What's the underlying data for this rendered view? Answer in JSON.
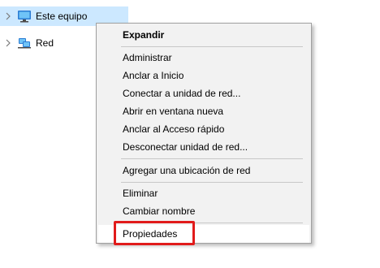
{
  "tree": {
    "items": [
      {
        "label": "Este equipo",
        "icon": "computer-icon",
        "selected": true
      },
      {
        "label": "Red",
        "icon": "network-icon",
        "selected": false
      }
    ]
  },
  "context_menu": {
    "items": [
      {
        "label": "Expandir",
        "bold": true
      },
      {
        "label": "Administrar"
      },
      {
        "label": "Anclar a Inicio"
      },
      {
        "label": "Conectar a unidad de red..."
      },
      {
        "label": "Abrir en ventana nueva"
      },
      {
        "label": "Anclar al Acceso rápido"
      },
      {
        "label": "Desconectar unidad de red..."
      },
      {
        "label": "Agregar una ubicación de red"
      },
      {
        "label": "Eliminar"
      },
      {
        "label": "Cambiar nombre"
      },
      {
        "label": "Propiedades",
        "highlighted": true
      }
    ]
  },
  "colors": {
    "selection": "#cce8ff",
    "menu_background": "#f2f2f2",
    "highlight_border": "#e11b1b"
  }
}
